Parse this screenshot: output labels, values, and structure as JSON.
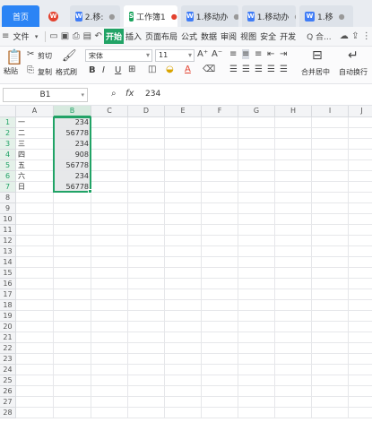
{
  "tabs": [
    {
      "label": "首页",
      "kind": "home"
    },
    {
      "label": "",
      "kind": "brand"
    },
    {
      "label": "2.移:",
      "kind": "doc"
    },
    {
      "label": "工作簿1",
      "kind": "sheet-active"
    },
    {
      "label": "1.移动办",
      "kind": "doc"
    },
    {
      "label": "1.移动办",
      "kind": "doc"
    },
    {
      "label": "1.移",
      "kind": "doc"
    }
  ],
  "menu": {
    "file": "文件",
    "items": [
      "开始",
      "插入",
      "页面布局",
      "公式",
      "数据",
      "审阅",
      "视图",
      "安全",
      "开发"
    ],
    "search": "Q 合..."
  },
  "ribbon": {
    "paste": "粘贴",
    "cut": "剪切",
    "copy": "复制",
    "format_painter": "格式刷",
    "font_name": "宋体",
    "font_size": "11",
    "merge": "合并居中",
    "wrap": "自动换行"
  },
  "formula_bar": {
    "cell_ref": "B1",
    "fx": "fx",
    "value": "234"
  },
  "sheet": {
    "columns": [
      "A",
      "B",
      "C",
      "D",
      "E",
      "F",
      "G",
      "H",
      "I",
      "J"
    ],
    "rows": [
      {
        "n": "1",
        "a": "一",
        "b": "234"
      },
      {
        "n": "2",
        "a": "二",
        "b": "56778"
      },
      {
        "n": "3",
        "a": "三",
        "b": "234"
      },
      {
        "n": "4",
        "a": "四",
        "b": "908"
      },
      {
        "n": "5",
        "a": "五",
        "b": "56778"
      },
      {
        "n": "6",
        "a": "六",
        "b": "234"
      },
      {
        "n": "7",
        "a": "日",
        "b": "56778"
      },
      {
        "n": "8",
        "a": "",
        "b": ""
      },
      {
        "n": "9",
        "a": "",
        "b": ""
      },
      {
        "n": "10",
        "a": "",
        "b": ""
      },
      {
        "n": "11",
        "a": "",
        "b": ""
      },
      {
        "n": "12",
        "a": "",
        "b": ""
      },
      {
        "n": "13",
        "a": "",
        "b": ""
      },
      {
        "n": "14",
        "a": "",
        "b": ""
      },
      {
        "n": "15",
        "a": "",
        "b": ""
      },
      {
        "n": "16",
        "a": "",
        "b": ""
      },
      {
        "n": "17",
        "a": "",
        "b": ""
      },
      {
        "n": "18",
        "a": "",
        "b": ""
      },
      {
        "n": "19",
        "a": "",
        "b": ""
      },
      {
        "n": "20",
        "a": "",
        "b": ""
      },
      {
        "n": "21",
        "a": "",
        "b": ""
      },
      {
        "n": "22",
        "a": "",
        "b": ""
      },
      {
        "n": "23",
        "a": "",
        "b": ""
      },
      {
        "n": "24",
        "a": "",
        "b": ""
      },
      {
        "n": "25",
        "a": "",
        "b": ""
      },
      {
        "n": "26",
        "a": "",
        "b": ""
      },
      {
        "n": "27",
        "a": "",
        "b": ""
      },
      {
        "n": "28",
        "a": "",
        "b": ""
      }
    ],
    "selected_column": "B",
    "selected_rows": 7
  },
  "colors": {
    "accent_green": "#21a366",
    "home_blue": "#2b84f5"
  }
}
